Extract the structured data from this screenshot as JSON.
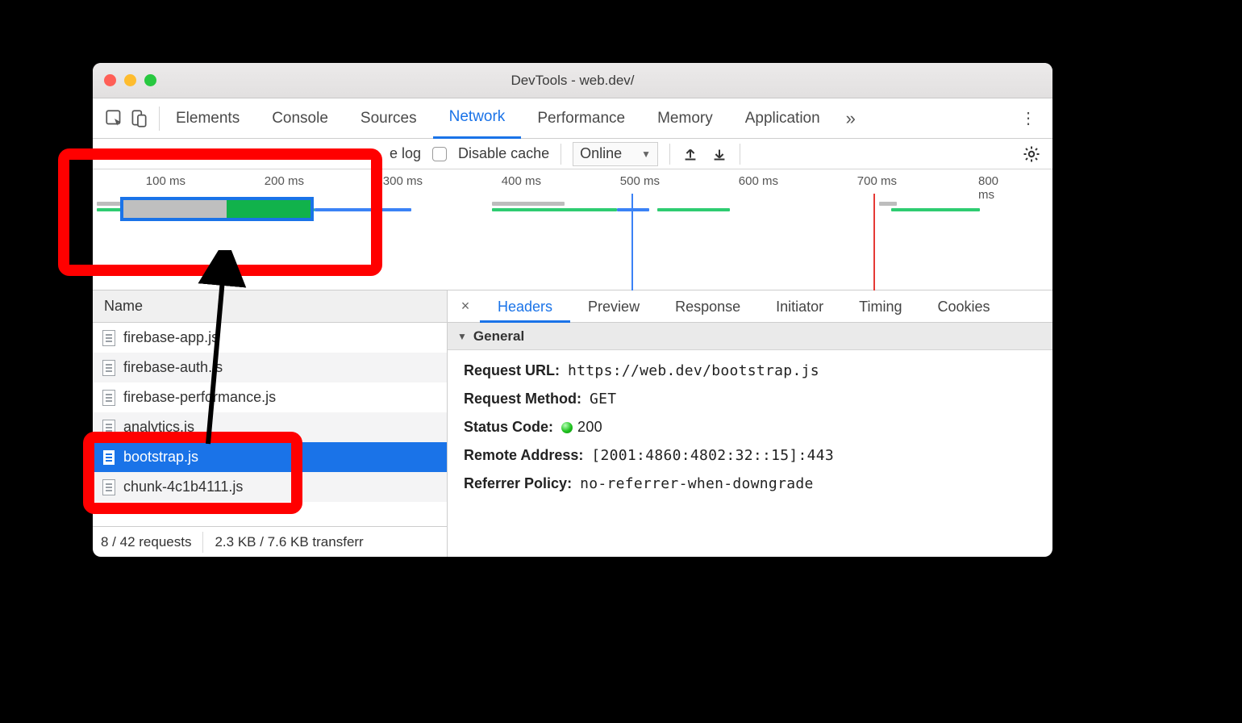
{
  "window": {
    "title": "DevTools - web.dev/"
  },
  "top_tabs": [
    "Elements",
    "Console",
    "Sources",
    "Network",
    "Performance",
    "Memory",
    "Application"
  ],
  "top_tab_active": "Network",
  "toolbar": {
    "log_label": "e log",
    "disable_cache_label": "Disable cache",
    "throttle_selected": "Online"
  },
  "timeline": {
    "ticks": [
      "100 ms",
      "200 ms",
      "300 ms",
      "400 ms",
      "500 ms",
      "600 ms",
      "700 ms",
      "800 ms"
    ]
  },
  "name_column": "Name",
  "files": [
    {
      "name": "firebase-app.js"
    },
    {
      "name": "firebase-auth.js"
    },
    {
      "name": "firebase-performance.js"
    },
    {
      "name": "analytics.js"
    },
    {
      "name": "bootstrap.js"
    },
    {
      "name": "chunk-4c1b4111.js"
    }
  ],
  "selected_file": "bootstrap.js",
  "status": {
    "requests": "8 / 42 requests",
    "transfer": "2.3 KB / 7.6 KB transferr"
  },
  "detail_tabs": [
    "Headers",
    "Preview",
    "Response",
    "Initiator",
    "Timing",
    "Cookies"
  ],
  "detail_tab_active": "Headers",
  "section_title": "General",
  "headers": {
    "request_url_k": "Request URL:",
    "request_url_v": "https://web.dev/bootstrap.js",
    "method_k": "Request Method:",
    "method_v": "GET",
    "status_k": "Status Code:",
    "status_v": "200",
    "remote_k": "Remote Address:",
    "remote_v": "[2001:4860:4802:32::15]:443",
    "referrer_k": "Referrer Policy:",
    "referrer_v": "no-referrer-when-downgrade"
  }
}
